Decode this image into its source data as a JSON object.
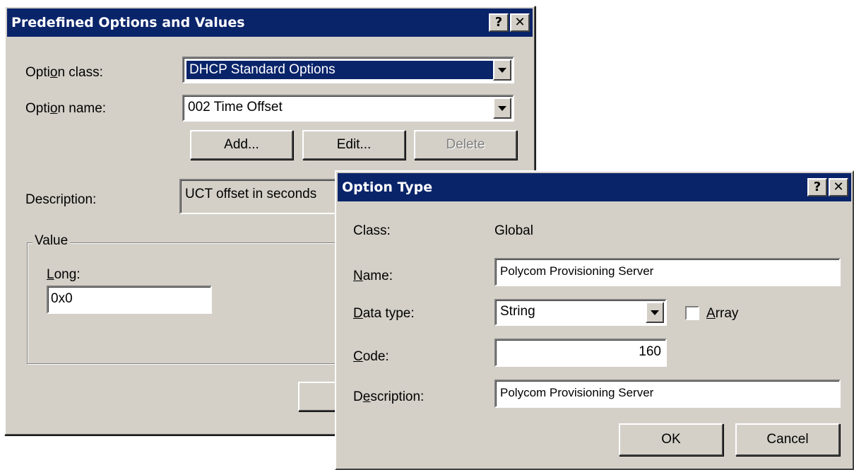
{
  "main_dialog": {
    "title": "Predefined Options and Values",
    "option_class_label": "Option class:",
    "option_class_value": "DHCP Standard Options",
    "option_name_label": "Option name:",
    "option_name_value": "002 Time Offset",
    "add_button": "Add...",
    "edit_button": "Edit...",
    "delete_button": "Delete",
    "description_label": "Description:",
    "description_value": "UCT offset in seconds",
    "value_group_title": "Value",
    "long_label": "Long:",
    "long_value": "0x0"
  },
  "option_type_dialog": {
    "title": "Option Type",
    "class_label": "Class:",
    "class_value": "Global",
    "name_label": "Name:",
    "name_value": "Polycom Provisioning Server",
    "data_type_label": "Data type:",
    "data_type_value": "String",
    "array_label": "Array",
    "array_checked": false,
    "code_label": "Code:",
    "code_value": "160",
    "description_label": "Description:",
    "description_value": "Polycom Provisioning Server",
    "ok_button": "OK",
    "cancel_button": "Cancel"
  },
  "title_buttons": {
    "help": "?",
    "close": "✕"
  },
  "colors": {
    "titlebar": "#0a246a",
    "dialog_face": "#d4d0c8",
    "selection": "#0a246a"
  }
}
